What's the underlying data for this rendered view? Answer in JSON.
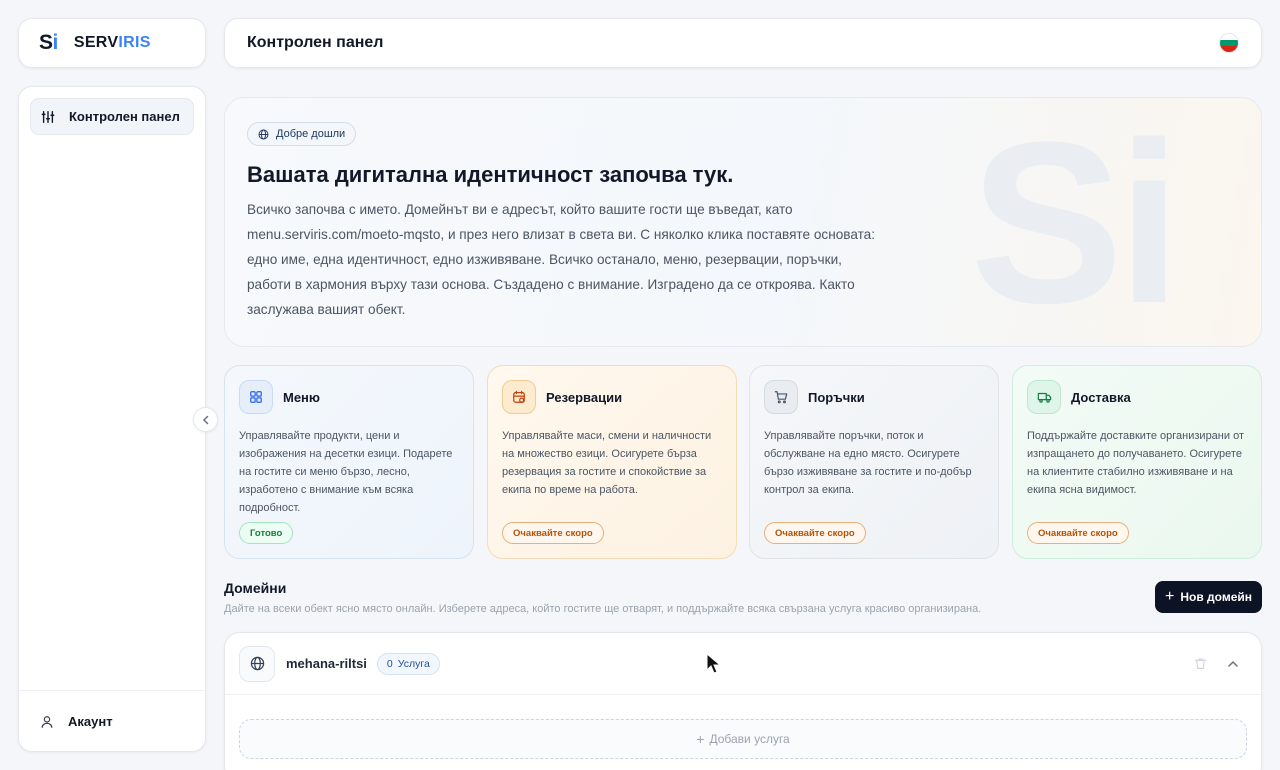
{
  "brand": {
    "mark_s": "S",
    "mark_i": "i",
    "word_a": "SERV",
    "word_b": "IRIS"
  },
  "sidebar": {
    "items": [
      {
        "label": "Контролен панел",
        "icon": "sliders-icon",
        "active": true
      }
    ],
    "account_label": "Акаунт"
  },
  "header": {
    "title": "Контролен панел",
    "flag_colors": [
      "#ffffff",
      "#00966e",
      "#d62612"
    ]
  },
  "hero": {
    "pill": "Добре дошли",
    "title": "Вашата дигитална идентичност започва тук.",
    "body": "Всичко започва с името. Домейнът ви е адресът, който вашите гости ще въведат, като menu.serviris.com/moeto-mqsto, и през него влизат в света ви. С няколко клика поставяте основата: едно име, една идентичност, едно изживяване. Всичко останало, меню, резервации, поръчки, работи в хармония върху тази основа. Създадено с внимание. Изградено да се откроява. Както заслужава вашият обект.",
    "ghost": "Si"
  },
  "features": [
    {
      "title": "Меню",
      "icon": "grid-icon",
      "desc": "Управлявайте продукти, цени и изображения на десетки езици. Подарете на гостите си меню бързо, лесно, изработено с внимание към всяка подробност.",
      "badge": "Готово"
    },
    {
      "title": "Резервации",
      "icon": "calendar-icon",
      "desc": "Управлявайте маси, смени и наличности на множество езици. Осигурете бърза резервация за гостите и спокойствие за екипа по време на работа.",
      "badge": "Очаквайте скоро"
    },
    {
      "title": "Поръчки",
      "icon": "cart-icon",
      "desc": "Управлявайте поръчки, поток и обслужване на едно място. Осигурете бързо изживяване за гостите и по-добър контрол за екипа.",
      "badge": "Очаквайте скоро"
    },
    {
      "title": "Доставка",
      "icon": "truck-icon",
      "desc": "Поддържайте доставките организирани от изпращането до получаването. Осигурете на клиентите стабилно изживяване и на екипа ясна видимост.",
      "badge": "Очаквайте скоро"
    }
  ],
  "domains": {
    "title": "Домейни",
    "desc": "Дайте на всеки обект ясно място онлайн. Изберете адреса, който гостите ще отварят, и поддържайте всяка свързана услуга красиво организирана.",
    "new_button": "Нов домейн",
    "items": [
      {
        "name": "mehana-riltsi",
        "service_count": "0",
        "service_label": "Услуга",
        "add_service": "Добави услуга"
      }
    ]
  },
  "colors": {
    "primary_dark": "#0b1324",
    "accent_blue": "#3b82f6",
    "ready_green": "#15803d",
    "soon_orange": "#b45309"
  }
}
